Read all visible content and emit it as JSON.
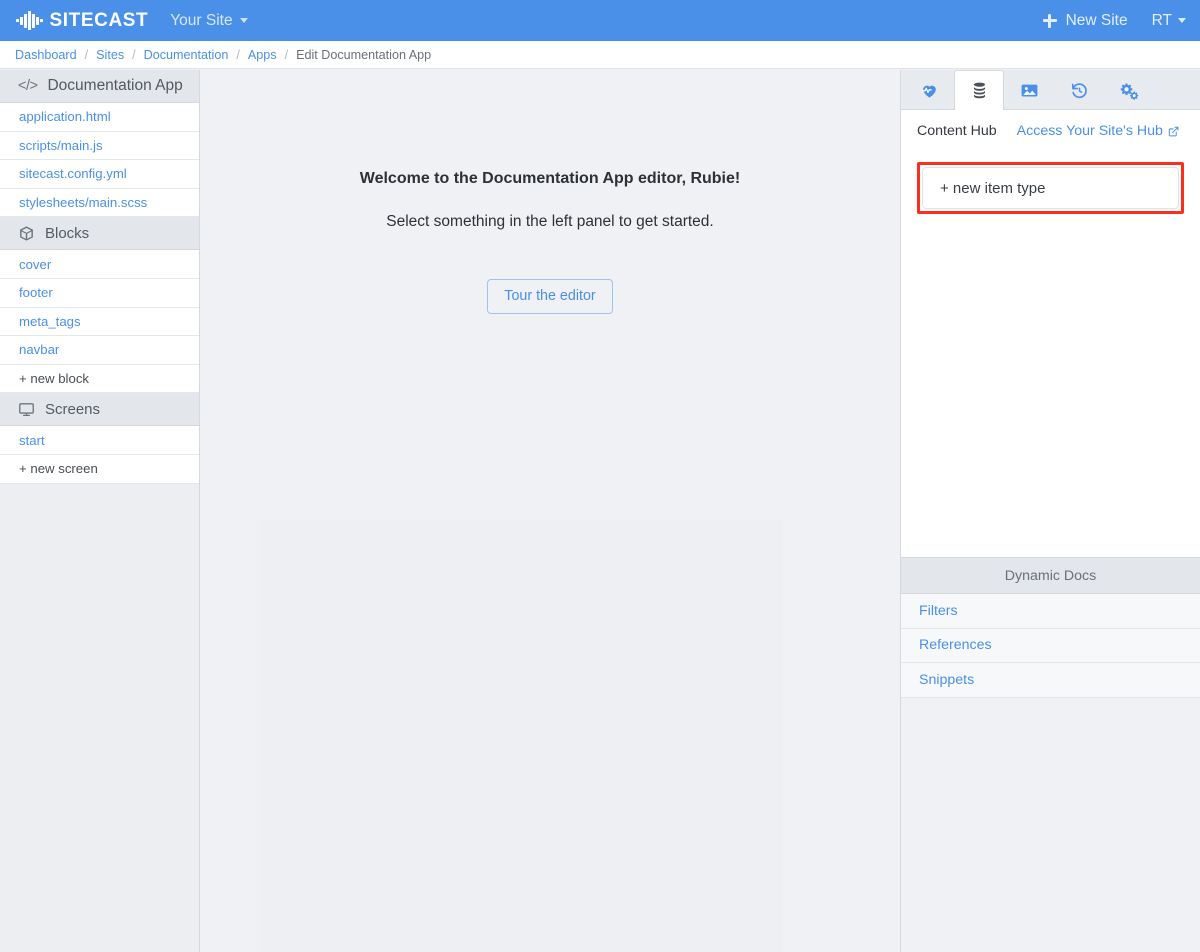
{
  "topnav": {
    "brand_name": "SITECAST",
    "brand_logo_icon": "waveform-icon",
    "site_switcher_label": "Your Site",
    "new_site_label": "New Site",
    "new_site_icon": "plus-icon",
    "user_initials": "RT"
  },
  "breadcrumb": {
    "separator": "/",
    "items": [
      {
        "label": "Dashboard",
        "current": false
      },
      {
        "label": "Sites",
        "current": false
      },
      {
        "label": "Documentation",
        "current": false
      },
      {
        "label": "Apps",
        "current": false
      },
      {
        "label": "Edit Documentation App",
        "current": true
      }
    ]
  },
  "sidebar": {
    "app_header": {
      "label": "Documentation App",
      "icon": "code-icon"
    },
    "files": [
      {
        "label": "application.html"
      },
      {
        "label": "scripts/main.js"
      },
      {
        "label": "sitecast.config.yml"
      },
      {
        "label": "stylesheets/main.scss"
      }
    ],
    "blocks_header": {
      "label": "Blocks",
      "icon": "cube-icon"
    },
    "blocks": [
      {
        "label": "cover"
      },
      {
        "label": "footer"
      },
      {
        "label": "meta_tags"
      },
      {
        "label": "navbar"
      }
    ],
    "new_block_label": "+ new block",
    "screens_header": {
      "label": "Screens",
      "icon": "monitor-icon"
    },
    "screens": [
      {
        "label": "start"
      }
    ],
    "new_screen_label": "+ new screen"
  },
  "canvas": {
    "welcome_title": "Welcome to the Documentation App editor, Rubie!",
    "welcome_subtitle": "Select something in the left panel to get started.",
    "tour_button_label": "Tour the editor"
  },
  "rightpanel": {
    "tabs": [
      {
        "icon": "heart-pulse-icon",
        "active": false
      },
      {
        "icon": "database-icon",
        "active": true
      },
      {
        "icon": "image-icon",
        "active": false
      },
      {
        "icon": "history-icon",
        "active": false
      },
      {
        "icon": "cogs-icon",
        "active": false
      }
    ],
    "panel_title": "Content Hub",
    "panel_link_label": "Access Your Site's Hub",
    "panel_link_icon": "external-link-icon",
    "new_item_type_label": "+ new item type",
    "highlight_color": "#fc2e20",
    "dynamic_docs_header": "Dynamic Docs",
    "dynamic_docs_links": [
      {
        "label": "Filters"
      },
      {
        "label": "References"
      },
      {
        "label": "Snippets"
      }
    ]
  },
  "colors": {
    "brand_blue": "#4a90e8",
    "link_blue": "#4a90e8",
    "highlight_red": "#fc2e20",
    "canvas_bg": "#eff1f4"
  }
}
